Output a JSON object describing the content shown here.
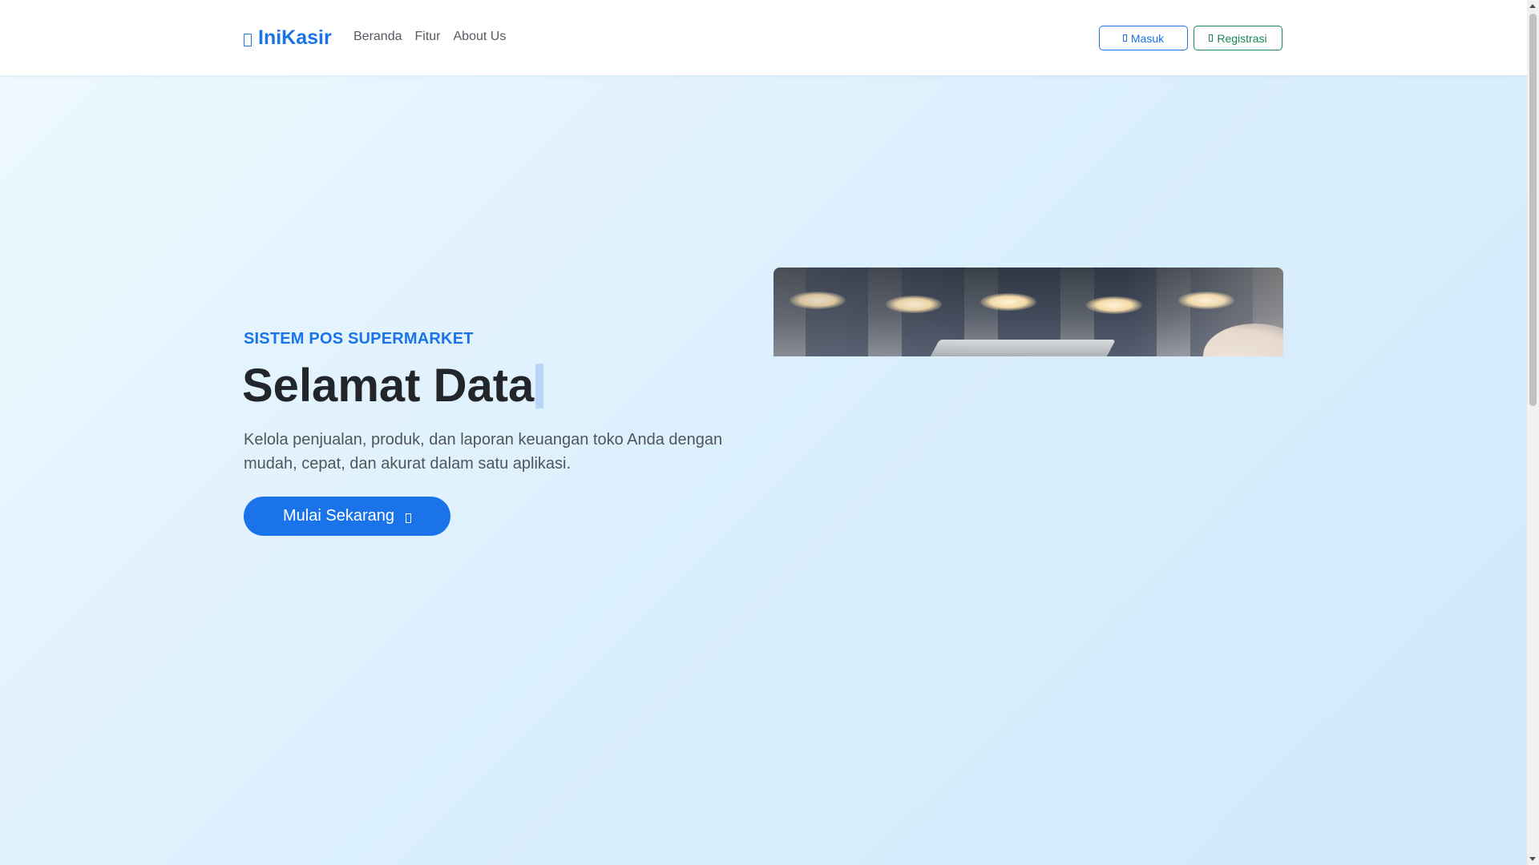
{
  "navbar": {
    "brand": "IniKasir",
    "links": [
      "Beranda",
      "Fitur",
      "About Us"
    ],
    "login_label": "Masuk",
    "register_label": "Registrasi"
  },
  "hero": {
    "eyebrow": "SISTEM POS SUPERMARKET",
    "headline": "Selamat Data",
    "subtext": "Kelola penjualan, produk, dan laporan keuangan toko Anda dengan mudah, cepat, dan akurat dalam satu aplikasi.",
    "cta_label": "Mulai Sekarang"
  },
  "colors": {
    "primary": "#1a73e8",
    "success": "#198754",
    "heading": "#22262a",
    "body_text": "#505559"
  },
  "icons": {
    "brand": "register-icon",
    "login": "login-icon",
    "register": "user-plus-icon",
    "cta": "arrow-right-icon"
  }
}
